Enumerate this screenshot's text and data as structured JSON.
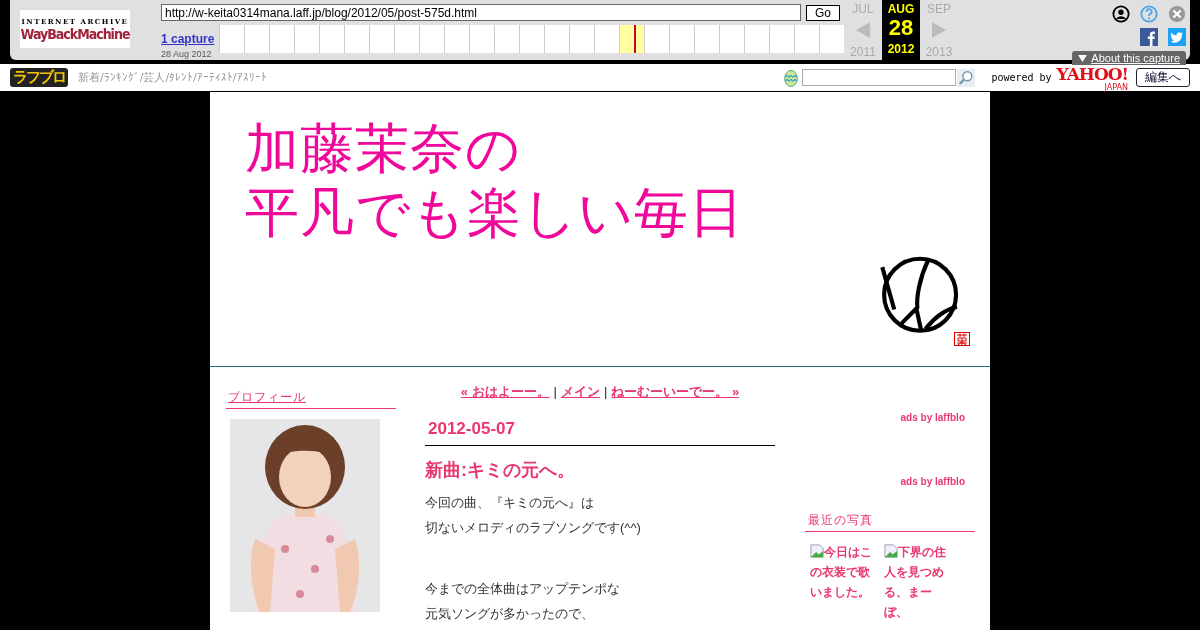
{
  "wayback": {
    "logo_top": "INTERNET ARCHIVE",
    "logo_main": "WayBackMachine",
    "url": "http://w-keita0314mana.laff.jp/blog/2012/05/post-575d.html",
    "go": "Go",
    "captures": "1 capture",
    "capture_date": "28 Aug 2012",
    "timeline": [
      {
        "selected": false
      },
      {
        "selected": false
      },
      {
        "selected": false
      },
      {
        "selected": false
      },
      {
        "selected": false
      },
      {
        "selected": false
      },
      {
        "selected": false
      },
      {
        "selected": false
      },
      {
        "selected": false
      },
      {
        "selected": false
      },
      {
        "selected": false
      },
      {
        "selected": false
      },
      {
        "selected": false
      },
      {
        "selected": false
      },
      {
        "selected": false
      },
      {
        "selected": false
      },
      {
        "selected": true
      },
      {
        "selected": false
      },
      {
        "selected": false
      },
      {
        "selected": false
      },
      {
        "selected": false
      },
      {
        "selected": false
      },
      {
        "selected": false
      },
      {
        "selected": false
      },
      {
        "selected": false
      }
    ],
    "calendar": [
      {
        "month": "JUL",
        "year": "2011",
        "selected": false
      },
      {
        "month": "AUG",
        "day": "28",
        "year": "2012",
        "selected": true
      },
      {
        "month": "SEP",
        "year": "2013",
        "selected": false
      }
    ],
    "about": "About this capture"
  },
  "laff_bar": {
    "logo": "ラフブロ",
    "links": "新着/ﾗﾝｷﾝｸﾞ/芸人/ﾀﾚﾝﾄ/ｱｰﾃｨｽﾄ/ｱｽﾘｰﾄ",
    "powered": "powered by",
    "yahoo": "YAHOO!",
    "yahoo_sub": "JAPAN",
    "edit": "編集へ"
  },
  "header": {
    "title_lines": [
      "加藤茉奈の",
      "平凡でも楽しい毎日"
    ]
  },
  "left": {
    "profile_heading": "プロフィール"
  },
  "post": {
    "nav": [
      {
        "kind": "link",
        "text": "« おはよーー。"
      },
      {
        "kind": "separator",
        "text": "|"
      },
      {
        "kind": "link",
        "text": "メイン"
      },
      {
        "kind": "separator",
        "text": "|"
      },
      {
        "kind": "link",
        "text": "ねーむーいーでー。 »"
      }
    ],
    "date": "2012-05-07",
    "title": "新曲:キミの元へ。",
    "paragraphs": [
      [
        "今回の曲、『キミの元へ』は",
        "切ないメロディのラブソングです(^^)"
      ],
      [
        "今までの全体曲はアップテンポな",
        "元気ソングが多かったので、"
      ]
    ]
  },
  "right": {
    "ads": [
      "ads by laffblo",
      "ads by laffblo"
    ],
    "photos_heading": "最近の写真",
    "photos": [
      {
        "caption": "今日はこの衣装で歌いました。"
      },
      {
        "caption": "下界の住人を見つめる、まーぼ、"
      }
    ]
  }
}
